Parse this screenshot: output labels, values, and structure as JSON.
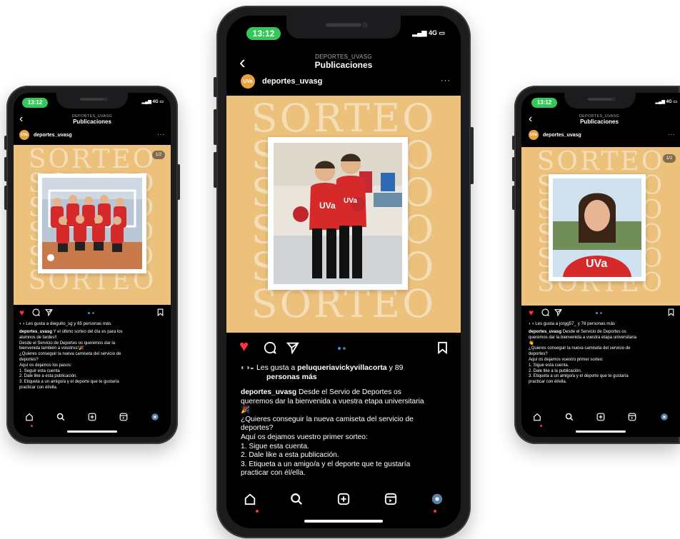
{
  "status": {
    "time": "13:12",
    "net": "4G"
  },
  "header": {
    "account_caps": "DEPORTES_UVASG",
    "title": "Publicaciones",
    "back_glyph": "‹"
  },
  "account": {
    "username": "deportes_uvasg",
    "avatar_text": "UVa",
    "more_glyph": "···"
  },
  "post_background_word": "SORTEO",
  "icons": {
    "like": "heart-icon",
    "comment": "comment-icon",
    "share": "send-icon",
    "save": "bookmark-icon",
    "home": "home-icon",
    "search": "search-icon",
    "add": "add-icon",
    "reels": "reels-icon",
    "profile": "profile-icon"
  },
  "colors": {
    "post_bg": "#ebc17c",
    "like_red": "#ff3040",
    "status_green": "#34c759",
    "jersey_red": "#d62a2a"
  },
  "phones": {
    "left": {
      "badge": "1/2",
      "likes": "Les gusta a dieguito_sg y 65 personas más",
      "caption_lines": [
        "Y el último sorteo del día es para los",
        "alumnos de tardes!!",
        "Desde el Servicio de Deportes os queremos dar la",
        "bienvenida también a vosotros!🎉",
        "¿Quieres conseguir la nueva camiseta del servicio de",
        "deportes?",
        "Aquí os dejamos los pasos:",
        "1. Seguir esta cuenta",
        "2. Dale like a esta publicación.",
        "3. Etiqueta a un amigo/a y el deporte que te gustaría",
        "practicar con él/ella."
      ]
    },
    "center": {
      "likes_prefix": "Les gusta a ",
      "likes_user": "peluqueriavickyvillacorta",
      "likes_suffix": " y 89",
      "likes_line2": "personas más",
      "caption_lines": [
        "Desde el Servio de Deportes os",
        "queremos dar la bienvenida a vuestra etapa universitaria",
        "🎉",
        "¿Quieres conseguir la nueva camiseta del servicio de",
        "deportes?",
        "Aquí os dejamos vuestro primer sorteo:",
        "1. Sigue esta cuenta.",
        "2. Dale like a esta publicación.",
        "3. Etiqueta a un amigo/a y el deporte que te gustaría",
        "practicar con él/ella."
      ]
    },
    "right": {
      "badge": "1/2",
      "likes": "Les gusta a jorgg57_ y 78 personas más",
      "caption_lines": [
        "Desde el Servicio de Deportes os",
        "queremos dar la bienvenida a vuestra etapa universitaria",
        "👋",
        "¿Quieres conseguir la nueva camiseta del servicio de",
        "deportes?",
        "Aquí os dejamos vuestro primer sorteo:",
        "1. Sigue esta cuenta.",
        "2. Dale like a la publicación.",
        "3. Etiqueta a un amigo/a y el deporte que te gustaría",
        "practicar con él/ella."
      ]
    }
  }
}
